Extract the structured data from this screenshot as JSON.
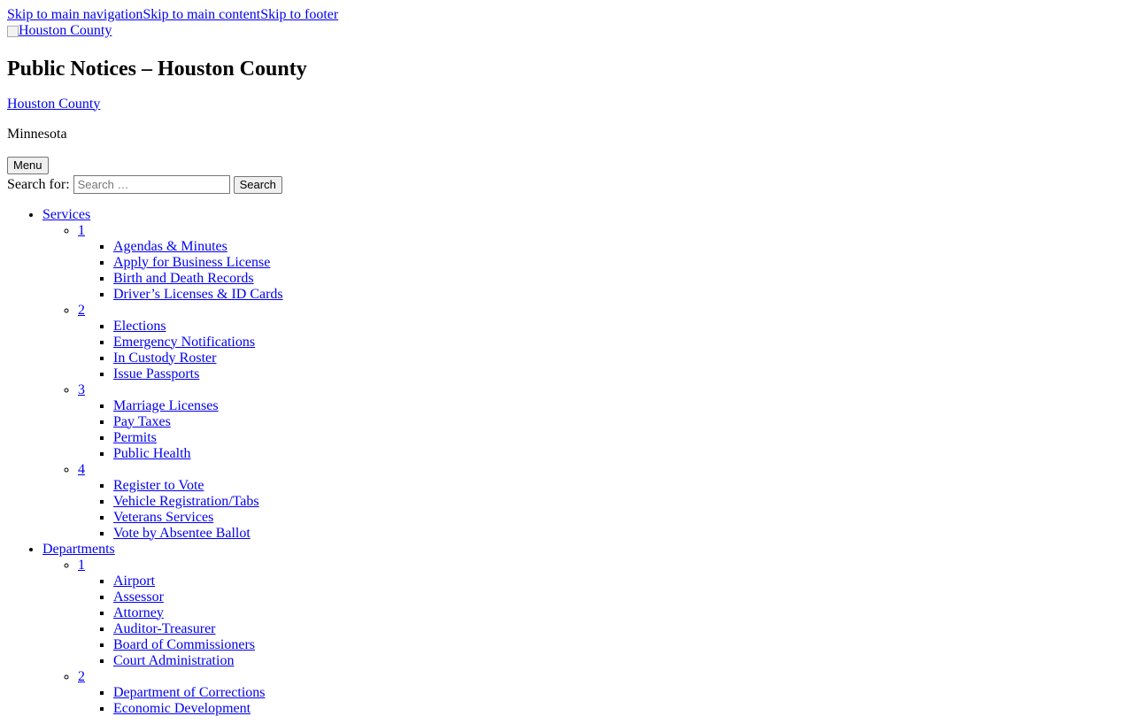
{
  "skip_links": [
    "Skip to main navigation",
    "Skip to main content",
    "Skip to footer"
  ],
  "logo_alt": "Houston County",
  "site_title": "Public Notices – Houston County",
  "county_link": "Houston County",
  "state": "Minnesota",
  "menu_button": "Menu",
  "search": {
    "label": "Search for:",
    "placeholder": "Search …",
    "button": "Search"
  },
  "nav": {
    "services": {
      "label": "Services",
      "groups": [
        {
          "label": "1",
          "items": [
            "Agendas & Minutes",
            "Apply for Business License",
            "Birth and Death Records",
            "Driver’s Licenses & ID Cards"
          ]
        },
        {
          "label": "2",
          "items": [
            "Elections",
            "Emergency Notifications",
            "In Custody Roster",
            "Issue Passports"
          ]
        },
        {
          "label": "3",
          "items": [
            "Marriage Licenses",
            "Pay Taxes",
            "Permits",
            "Public Health"
          ]
        },
        {
          "label": "4",
          "items": [
            "Register to Vote",
            "Vehicle Registration/Tabs",
            "Veterans Services",
            "Vote by Absentee Ballot"
          ]
        }
      ]
    },
    "departments": {
      "label": "Departments",
      "groups": [
        {
          "label": "1",
          "items": [
            "Airport",
            "Assessor",
            "Attorney",
            "Auditor-Treasurer",
            "Board of Commissioners",
            "Court Administration"
          ]
        },
        {
          "label": "2",
          "items": [
            "Department of Corrections",
            "Economic Development"
          ]
        }
      ]
    }
  }
}
